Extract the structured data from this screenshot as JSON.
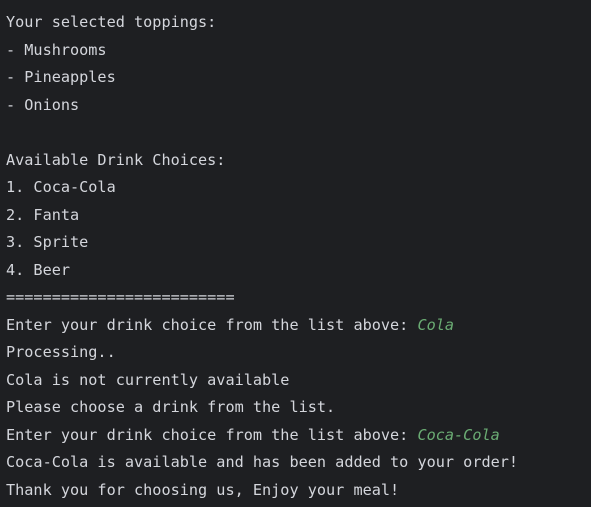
{
  "console": {
    "lines": [
      {
        "text": "Your selected toppings:"
      },
      {
        "text": "- Mushrooms"
      },
      {
        "text": "- Pineapples"
      },
      {
        "text": "- Onions"
      },
      {
        "text": ""
      },
      {
        "text": "Available Drink Choices:"
      },
      {
        "text": "1. Coca-Cola"
      },
      {
        "text": "2. Fanta"
      },
      {
        "text": "3. Sprite"
      },
      {
        "text": "4. Beer"
      },
      {
        "text": "========================="
      },
      {
        "text": "Enter your drink choice from the list above: ",
        "input": "Cola"
      },
      {
        "text": "Processing.."
      },
      {
        "text": "Cola is not currently available"
      },
      {
        "text": "Please choose a drink from the list."
      },
      {
        "text": "Enter your drink choice from the list above: ",
        "input": "Coca-Cola"
      },
      {
        "text": "Coca-Cola is available and has been added to your order!"
      },
      {
        "text": "Thank you for choosing us, Enjoy your meal!"
      }
    ]
  },
  "colors": {
    "background": "#1e1f22",
    "output_text": "#d4d6dc",
    "user_input": "#6aab73"
  }
}
